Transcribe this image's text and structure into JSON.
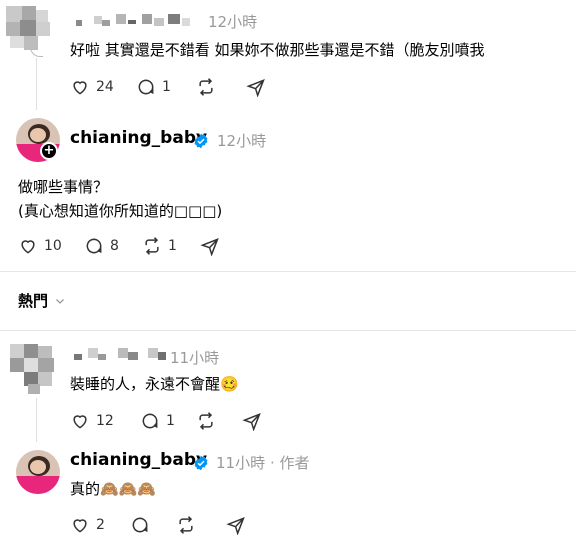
{
  "post1": {
    "time": "12小時",
    "text": "好啦 其實還是不錯看 如果妳不做那些事還是不錯（脆友別噴我",
    "likes": "24",
    "replies": "1"
  },
  "post2": {
    "username": "chianing_baby",
    "time": "12小時",
    "text_line1": "做哪些事情？",
    "text_line2": "(真心想知道你所知道的□□□)",
    "likes": "10",
    "replies": "8",
    "reposts": "1"
  },
  "sort": {
    "label": "熱門"
  },
  "post3": {
    "time": "11小時",
    "text": "裝睡的人，永遠不會醒🥴",
    "likes": "12",
    "replies": "1"
  },
  "post4": {
    "username": "chianing_baby",
    "time": "11小時",
    "author_tag": "· 作者",
    "text": "真的🙈🙈🙈",
    "likes": "2"
  },
  "colors": {
    "verified": "#0095f6",
    "muted": "#999999",
    "divider": "#e6e6e6"
  }
}
